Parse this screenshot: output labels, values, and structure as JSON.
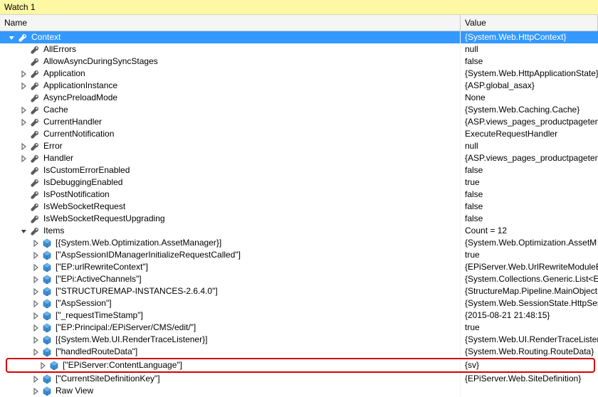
{
  "window": {
    "title": "Watch 1"
  },
  "columns": {
    "name": "Name",
    "value": "Value"
  },
  "rows": [
    {
      "depth": 0,
      "exp": "open",
      "icon": "wrench",
      "name": "Context",
      "value": "{System.Web.HttpContext}",
      "selected": true
    },
    {
      "depth": 1,
      "exp": "none",
      "icon": "wrench",
      "name": "AllErrors",
      "value": "null"
    },
    {
      "depth": 1,
      "exp": "none",
      "icon": "wrench",
      "name": "AllowAsyncDuringSyncStages",
      "value": "false"
    },
    {
      "depth": 1,
      "exp": "closed",
      "icon": "wrench",
      "name": "Application",
      "value": "{System.Web.HttpApplicationState}"
    },
    {
      "depth": 1,
      "exp": "closed",
      "icon": "wrench",
      "name": "ApplicationInstance",
      "value": "{ASP.global_asax}"
    },
    {
      "depth": 1,
      "exp": "none",
      "icon": "wrench",
      "name": "AsyncPreloadMode",
      "value": "None"
    },
    {
      "depth": 1,
      "exp": "closed",
      "icon": "wrench",
      "name": "Cache",
      "value": "{System.Web.Caching.Cache}"
    },
    {
      "depth": 1,
      "exp": "closed",
      "icon": "wrench",
      "name": "CurrentHandler",
      "value": "{ASP.views_pages_productpagetem"
    },
    {
      "depth": 1,
      "exp": "none",
      "icon": "wrench",
      "name": "CurrentNotification",
      "value": "ExecuteRequestHandler"
    },
    {
      "depth": 1,
      "exp": "closed",
      "icon": "wrench",
      "name": "Error",
      "value": "null"
    },
    {
      "depth": 1,
      "exp": "closed",
      "icon": "wrench",
      "name": "Handler",
      "value": "{ASP.views_pages_productpagetem"
    },
    {
      "depth": 1,
      "exp": "none",
      "icon": "wrench",
      "name": "IsCustomErrorEnabled",
      "value": "false"
    },
    {
      "depth": 1,
      "exp": "none",
      "icon": "wrench",
      "name": "IsDebuggingEnabled",
      "value": "true"
    },
    {
      "depth": 1,
      "exp": "none",
      "icon": "wrench",
      "name": "IsPostNotification",
      "value": "false"
    },
    {
      "depth": 1,
      "exp": "none",
      "icon": "wrench",
      "name": "IsWebSocketRequest",
      "value": "false"
    },
    {
      "depth": 1,
      "exp": "none",
      "icon": "wrench",
      "name": "IsWebSocketRequestUpgrading",
      "value": "false"
    },
    {
      "depth": 1,
      "exp": "open",
      "icon": "wrench",
      "name": "Items",
      "value": "Count = 12"
    },
    {
      "depth": 2,
      "exp": "closed",
      "icon": "cube",
      "name": "[{System.Web.Optimization.AssetManager}]",
      "value": "{System.Web.Optimization.AssetM"
    },
    {
      "depth": 2,
      "exp": "closed",
      "icon": "cube",
      "name": "[\"AspSessionIDManagerInitializeRequestCalled\"]",
      "value": "true"
    },
    {
      "depth": 2,
      "exp": "closed",
      "icon": "cube",
      "name": "[\"EP:urlRewriteContext\"]",
      "value": "{EPiServer.Web.UrlRewriteModuleB"
    },
    {
      "depth": 2,
      "exp": "closed",
      "icon": "cube",
      "name": "[\"EPi:ActiveChannels\"]",
      "value": "{System.Collections.Generic.List<EP"
    },
    {
      "depth": 2,
      "exp": "closed",
      "icon": "cube",
      "name": "[\"STRUCTUREMAP-INSTANCES-2.6.4.0\"]",
      "value": "{StructureMap.Pipeline.MainObject"
    },
    {
      "depth": 2,
      "exp": "closed",
      "icon": "cube",
      "name": "[\"AspSession\"]",
      "value": "{System.Web.SessionState.HttpSess"
    },
    {
      "depth": 2,
      "exp": "closed",
      "icon": "cube",
      "name": "[\"_requestTimeStamp\"]",
      "value": "{2015-08-21 21:48:15}"
    },
    {
      "depth": 2,
      "exp": "closed",
      "icon": "cube",
      "name": "[\"EP:Principal:/EPiServer/CMS/edit/\"]",
      "value": "true"
    },
    {
      "depth": 2,
      "exp": "closed",
      "icon": "cube",
      "name": "[{System.Web.UI.RenderTraceListener}]",
      "value": "{System.Web.UI.RenderTraceListene"
    },
    {
      "depth": 2,
      "exp": "closed",
      "icon": "cube",
      "name": "[\"handledRouteData\"]",
      "value": "{System.Web.Routing.RouteData}"
    },
    {
      "depth": 2,
      "exp": "closed",
      "icon": "cube",
      "name": "[\"EPiServer:ContentLanguage\"]",
      "value": "{sv}",
      "highlight": true
    },
    {
      "depth": 2,
      "exp": "closed",
      "icon": "cube",
      "name": "[\"CurrentSiteDefinitionKey\"]",
      "value": "{EPiServer.Web.SiteDefinition}"
    },
    {
      "depth": 2,
      "exp": "closed",
      "icon": "cube",
      "name": "Raw View",
      "value": ""
    }
  ]
}
